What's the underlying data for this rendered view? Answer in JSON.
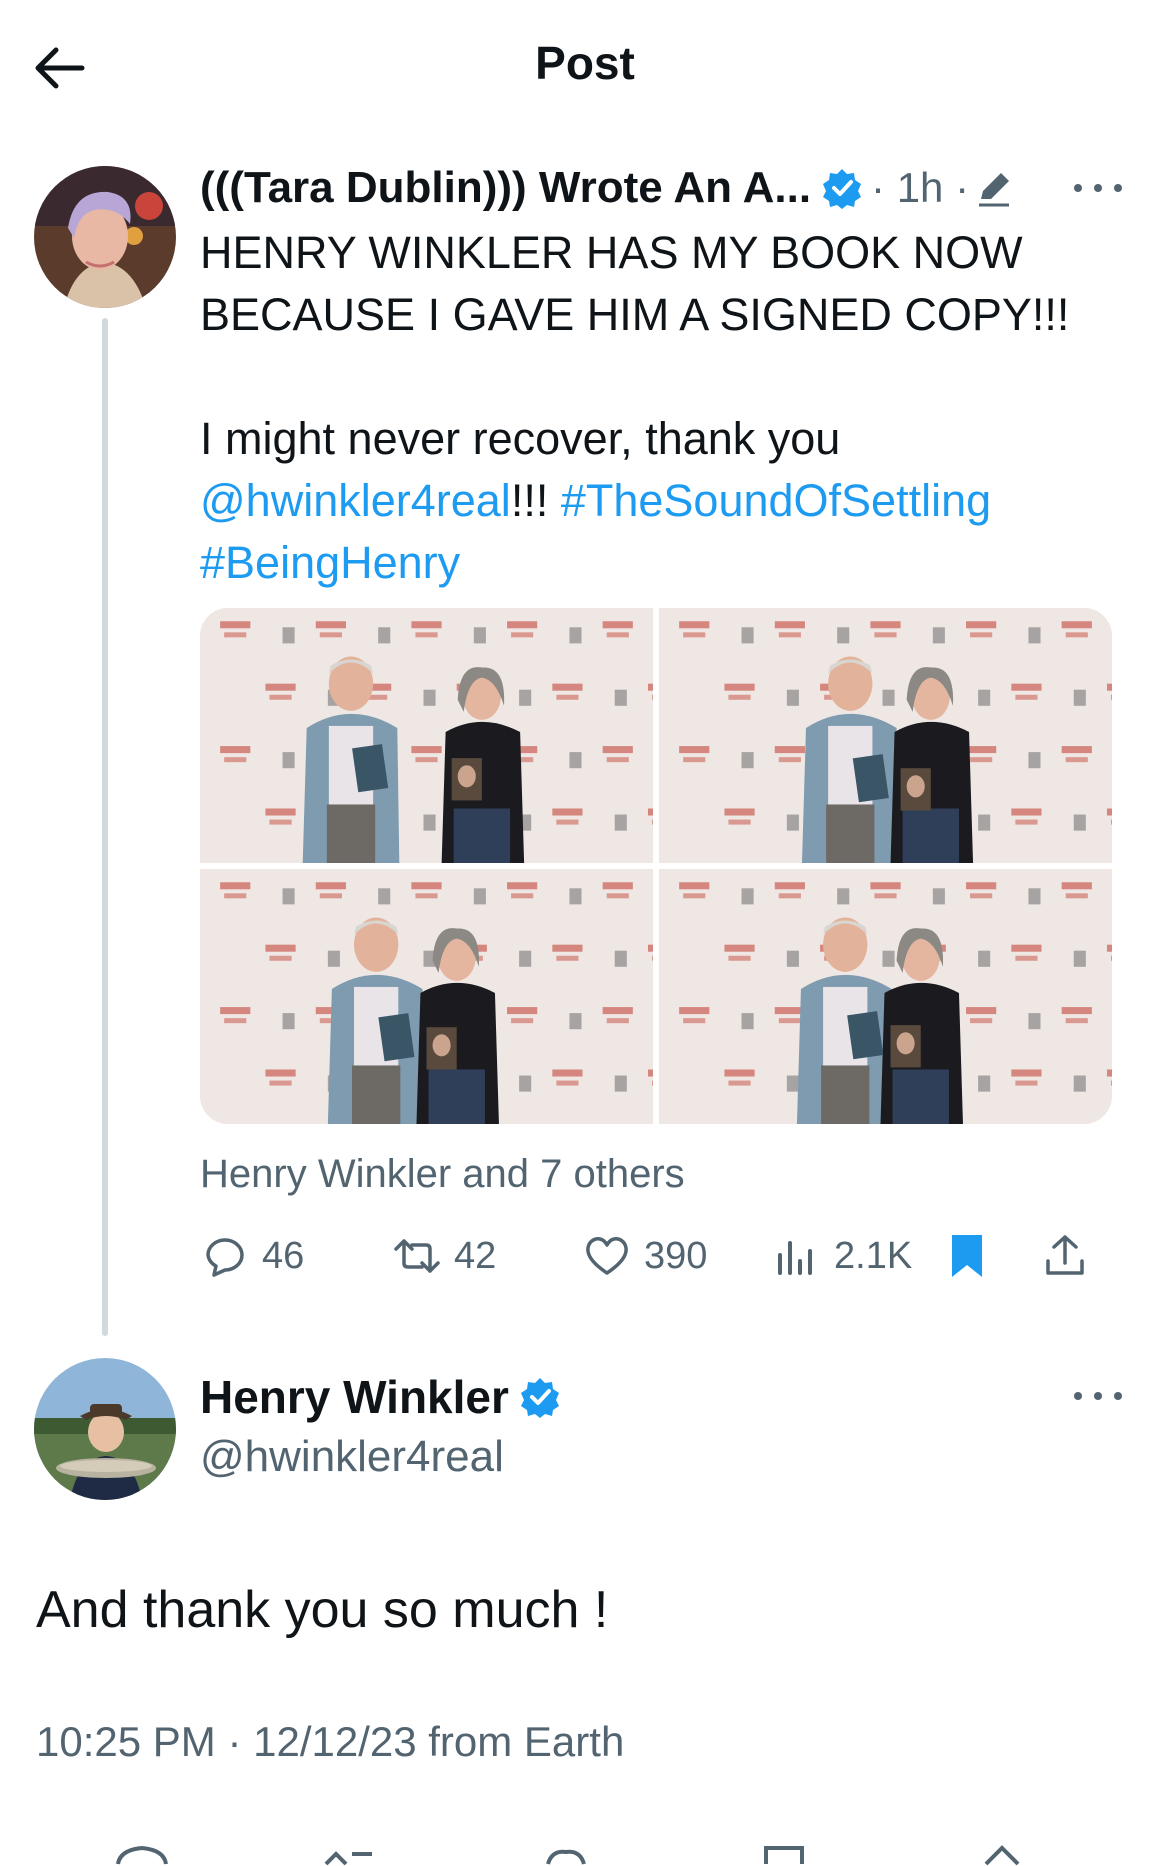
{
  "header": {
    "title": "Post"
  },
  "tweet1": {
    "author_name": "(((Tara Dublin))) Wrote An A...",
    "time": "· 1h ·",
    "line1": "HENRY WINKLER HAS MY BOOK NOW",
    "line2": "BECAUSE I GAVE HIM A SIGNED COPY!!!",
    "line3": "I might never recover, thank you",
    "mention": "@hwinkler4real",
    "after_mention": "!!! ",
    "hashtag1": "#TheSoundOfSettling",
    "hashtag2": "#BeingHenry",
    "liked_by": "Henry Winkler and 7 others",
    "replies": "46",
    "reposts": "42",
    "likes": "390",
    "views": "2.1K"
  },
  "tweet2": {
    "author_name": "Henry Winkler",
    "handle": "@hwinkler4real",
    "text": "And thank you so much !",
    "timestamp": "10:25 PM · 12/12/23 from Earth"
  },
  "colors": {
    "link": "#1d9bf0",
    "verified": "#1d9bf0",
    "muted": "#536471",
    "bookmark": "#1d9bf0"
  }
}
